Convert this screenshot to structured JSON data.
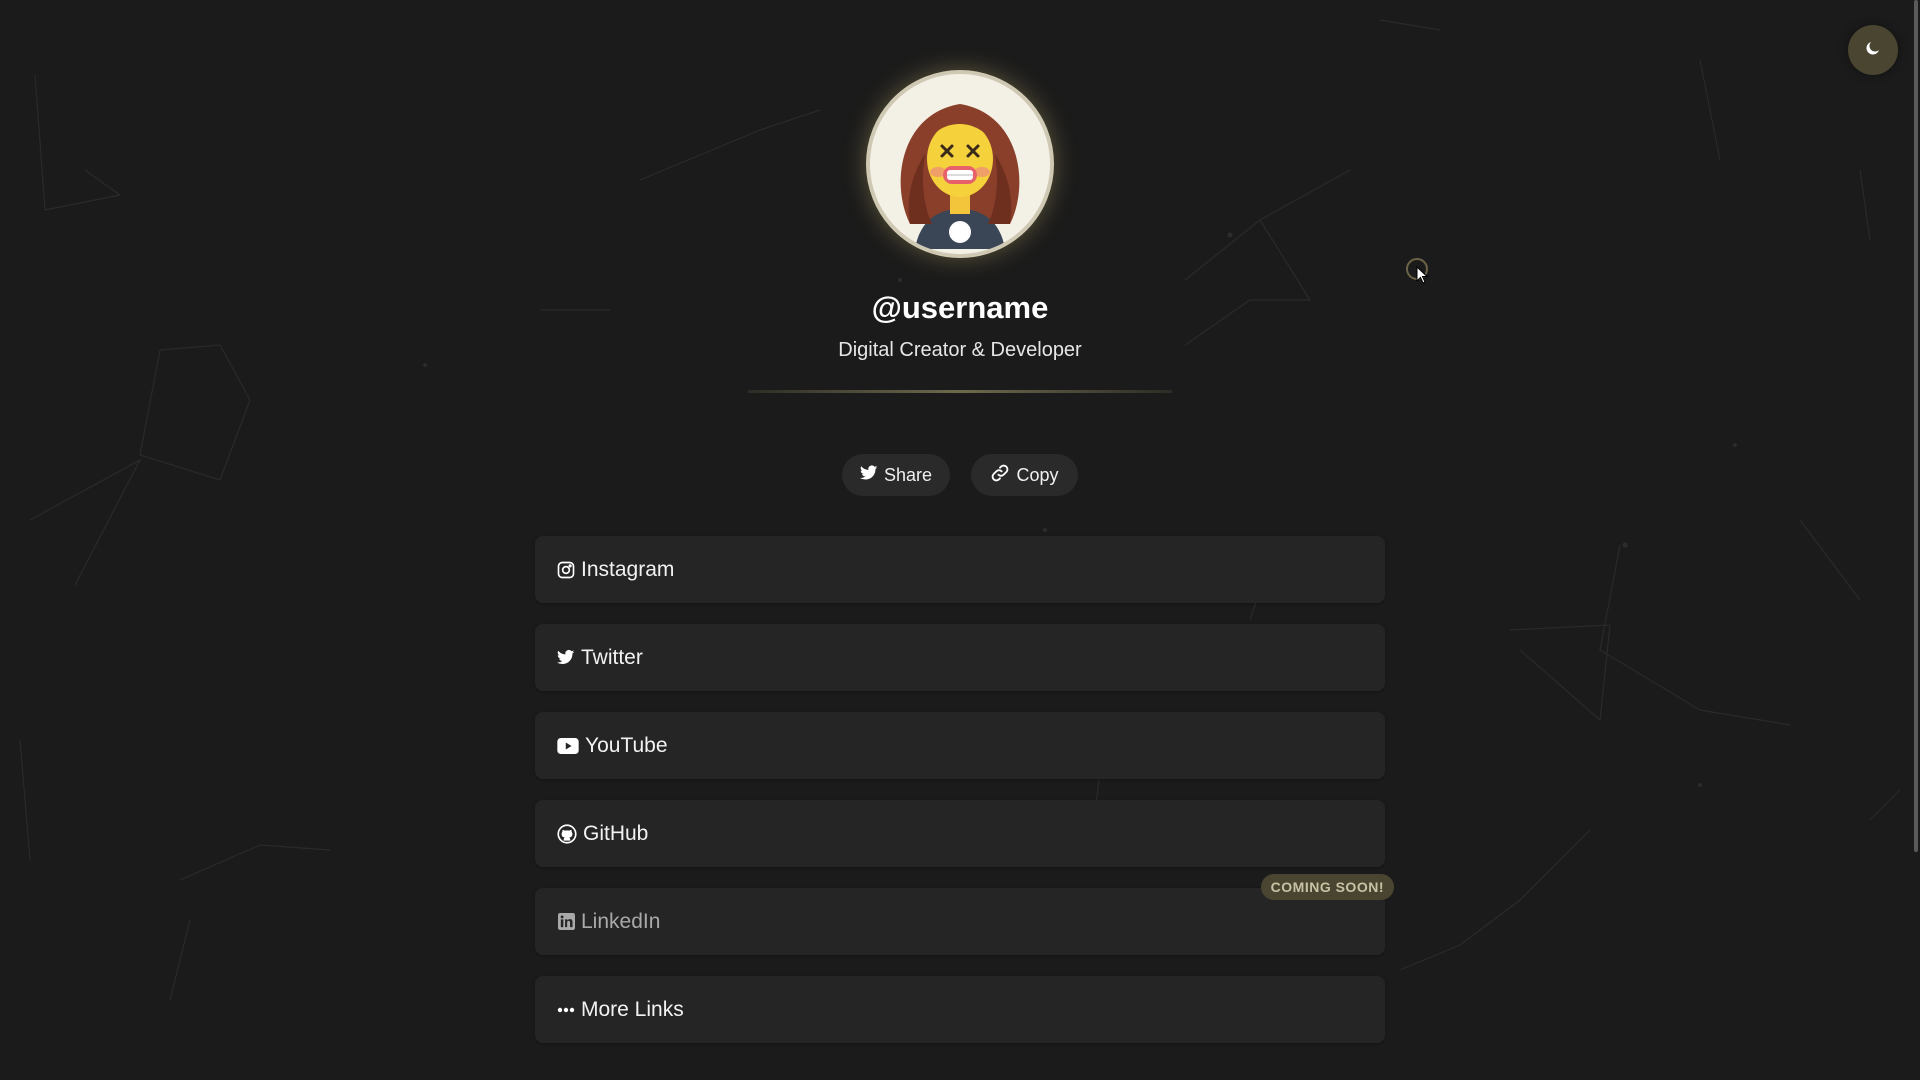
{
  "theme_toggle": {
    "icon": "moon-icon"
  },
  "profile": {
    "avatar_alt": "avatar",
    "username": "@username",
    "bio": "Digital Creator & Developer"
  },
  "actions": {
    "share_label": "Share",
    "share_icon": "twitter-icon",
    "copy_label": "Copy",
    "copy_icon": "link-icon"
  },
  "links": [
    {
      "label": "Instagram",
      "icon": "instagram-icon"
    },
    {
      "label": "Twitter",
      "icon": "twitter-icon"
    },
    {
      "label": "YouTube",
      "icon": "youtube-icon"
    },
    {
      "label": "GitHub",
      "icon": "github-icon"
    },
    {
      "label": "LinkedIn",
      "icon": "linkedin-icon",
      "badge": "COMING SOON!",
      "disabled": true
    },
    {
      "label": "More Links",
      "icon": "more-dots-icon"
    }
  ],
  "colors": {
    "background": "#1b1b1b",
    "card": "#252525",
    "accent": "#4a4530",
    "accent_text": "#c8c2a4"
  }
}
